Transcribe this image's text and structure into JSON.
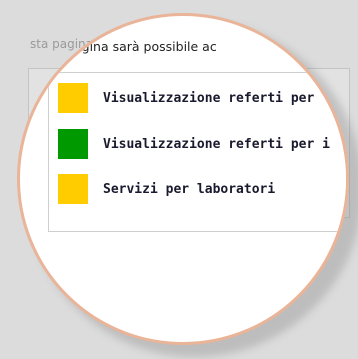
{
  "intro_text": "sta pagina sarà possibile ac",
  "background_intro_text": "sta pagina sarà possibile ac",
  "services": [
    {
      "label": "Visualizzazione referti per",
      "status_color": "#ffcc00"
    },
    {
      "label": "Visualizzazione referti per i",
      "status_color": "#009900"
    },
    {
      "label": "Servizi per laboratori",
      "status_color": "#ffcc00"
    }
  ]
}
